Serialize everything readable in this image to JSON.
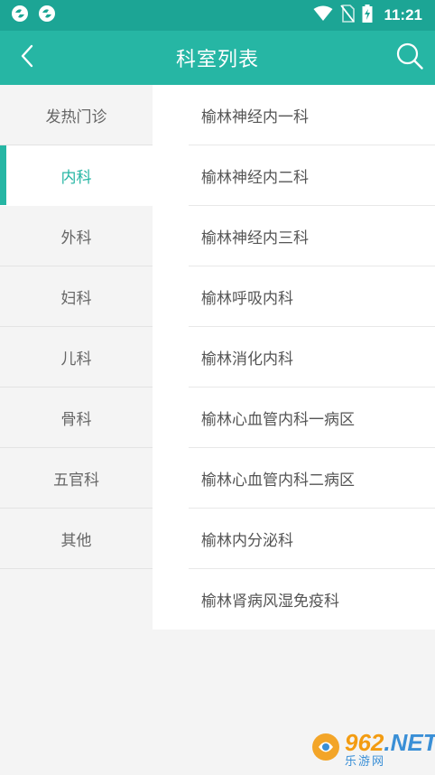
{
  "status_bar": {
    "time": "11:21",
    "left_icons": [
      "app-notification-icon",
      "app-notification-icon"
    ],
    "right_icons": [
      "wifi-icon",
      "no-sim-icon",
      "battery-charging-icon"
    ]
  },
  "app_bar": {
    "title": "科室列表",
    "back_icon": "chevron-left-icon",
    "search_icon": "search-icon"
  },
  "sidebar": {
    "active_index": 1,
    "items": [
      {
        "label": "发热门诊"
      },
      {
        "label": "内科"
      },
      {
        "label": "外科"
      },
      {
        "label": "妇科"
      },
      {
        "label": "儿科"
      },
      {
        "label": "骨科"
      },
      {
        "label": "五官科"
      },
      {
        "label": "其他"
      }
    ]
  },
  "departments": [
    {
      "label": "榆林神经内一科"
    },
    {
      "label": "榆林神经内二科"
    },
    {
      "label": "榆林神经内三科"
    },
    {
      "label": "榆林呼吸内科"
    },
    {
      "label": "榆林消化内科"
    },
    {
      "label": "榆林心血管内科一病区"
    },
    {
      "label": "榆林心血管内科二病区"
    },
    {
      "label": "榆林内分泌科"
    },
    {
      "label": "榆林肾病风湿免疫科"
    }
  ],
  "watermark": {
    "main": "962",
    "suffix": ".NET",
    "sub": "乐游网"
  },
  "colors": {
    "status_bar": "#1ca595",
    "app_bar": "#26b6a4",
    "accent": "#26b6a4"
  }
}
